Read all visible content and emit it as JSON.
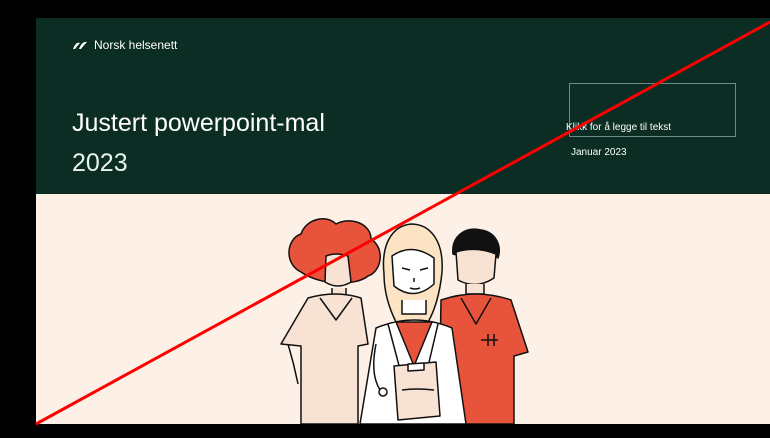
{
  "slide": {
    "brand": "Norsk helsenett",
    "title": "Justert powerpoint-mal",
    "year": "2023",
    "placeholder": "Klikk for å legge til tekst",
    "date": "Januar 2023"
  },
  "colors": {
    "header_bg": "#0b2d24",
    "body_bg": "#fdf0e6",
    "accent_red": "#e8543b",
    "cross_line": "#ff0000"
  },
  "icons": {
    "logo": "norsk-helsenett-logo-icon",
    "illustration": "healthcare-workers-illustration"
  }
}
